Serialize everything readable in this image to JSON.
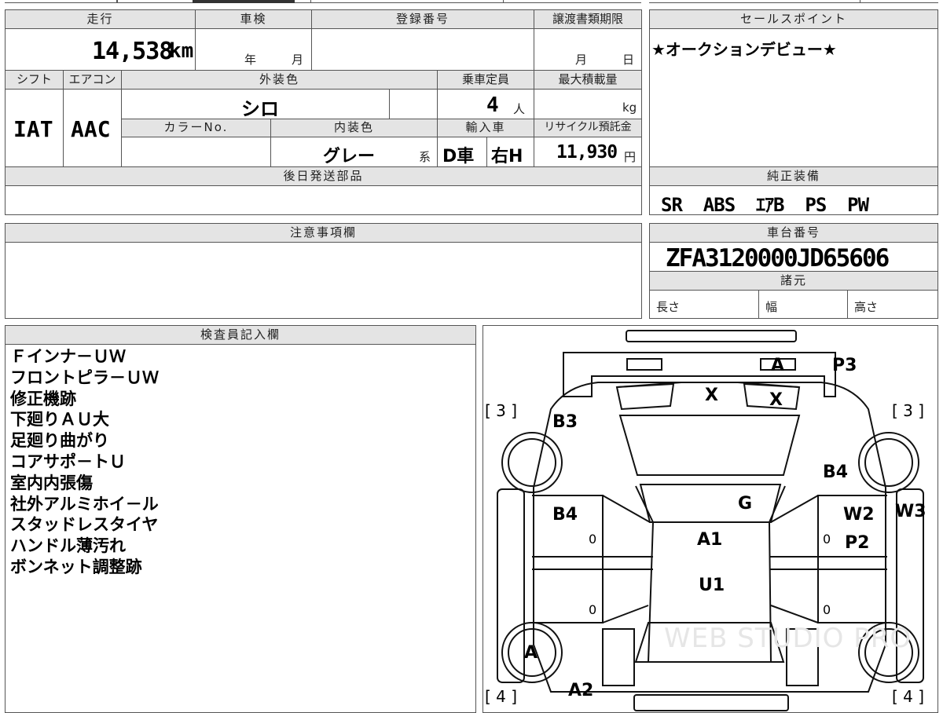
{
  "vehicle": {
    "labels": {
      "mileage": "走行",
      "inspection": "車検",
      "registration_no": "登録番号",
      "transfer_deadline": "譲渡書類期限",
      "shift": "シフト",
      "aircon": "エアコン",
      "exterior_color": "外装色",
      "capacity": "乗車定員",
      "max_load": "最大積載量",
      "color_no": "カラーNo.",
      "interior_color": "内装色",
      "import": "輸入車",
      "recycle_fee": "リサイクル預託金",
      "later_parts": "後日発送部品"
    },
    "mileage_value": "14,538",
    "mileage_unit": "km",
    "inspection_year_label": "年",
    "inspection_month_label": "月",
    "transfer_month_label": "月",
    "transfer_day_label": "日",
    "shift_value": "IAT",
    "aircon_value": "AAC",
    "exterior_color_value": "シロ",
    "capacity_value": "4",
    "capacity_unit": "人",
    "max_load_unit": "kg",
    "interior_color_value": "グレー",
    "interior_suffix": "系",
    "import_value": "D車",
    "handle_value": "右H",
    "recycle_value": "11,930",
    "recycle_unit": "円"
  },
  "sales_point": {
    "header": "セールスポイント",
    "text": "★オークションデビュー★"
  },
  "equipment": {
    "header": "純正装備",
    "text": "SR  ABS  ｴｱB  PS  PW"
  },
  "notes": {
    "header": "注意事項欄"
  },
  "chassis": {
    "header": "車台番号",
    "number": "ZFA3120000JD65606",
    "specs_header": "諸元",
    "length_label": "長さ",
    "width_label": "幅",
    "height_label": "高さ"
  },
  "inspector": {
    "header": "検査員記入欄",
    "remarks": [
      "Ｆインナ－ＵＷ",
      "フロントピラ－ＵＷ",
      "修正機跡",
      "下廻りＡＵ大",
      "足廻り曲がり",
      "コアサポ－トＵ",
      "室内内張傷",
      "社外アルミホイ－ル",
      "スタッドレスタイヤ",
      "ハンドル薄汚れ",
      "ボンネット調整跡"
    ]
  },
  "diagram": {
    "marks": {
      "front_a": "A",
      "p3": "P3",
      "x1": "X",
      "x2": "X",
      "b3": "B3",
      "b4_right": "B4",
      "b4_left": "B4",
      "g": "G",
      "w2": "W2",
      "w3": "W3",
      "p2": "P2",
      "a1": "A1",
      "u1": "U1",
      "wheel_a": "A",
      "a2": "A2",
      "zero_1": "0",
      "zero_2": "0",
      "zero_3": "0",
      "zero_4": "0"
    },
    "tire_depth": {
      "front_left": "[ 3 ]",
      "front_right": "[ 3 ]",
      "rear_left": "[ 4 ]",
      "rear_right": "[ 4 ]"
    },
    "watermark": "WEB STUDIO PRO"
  }
}
